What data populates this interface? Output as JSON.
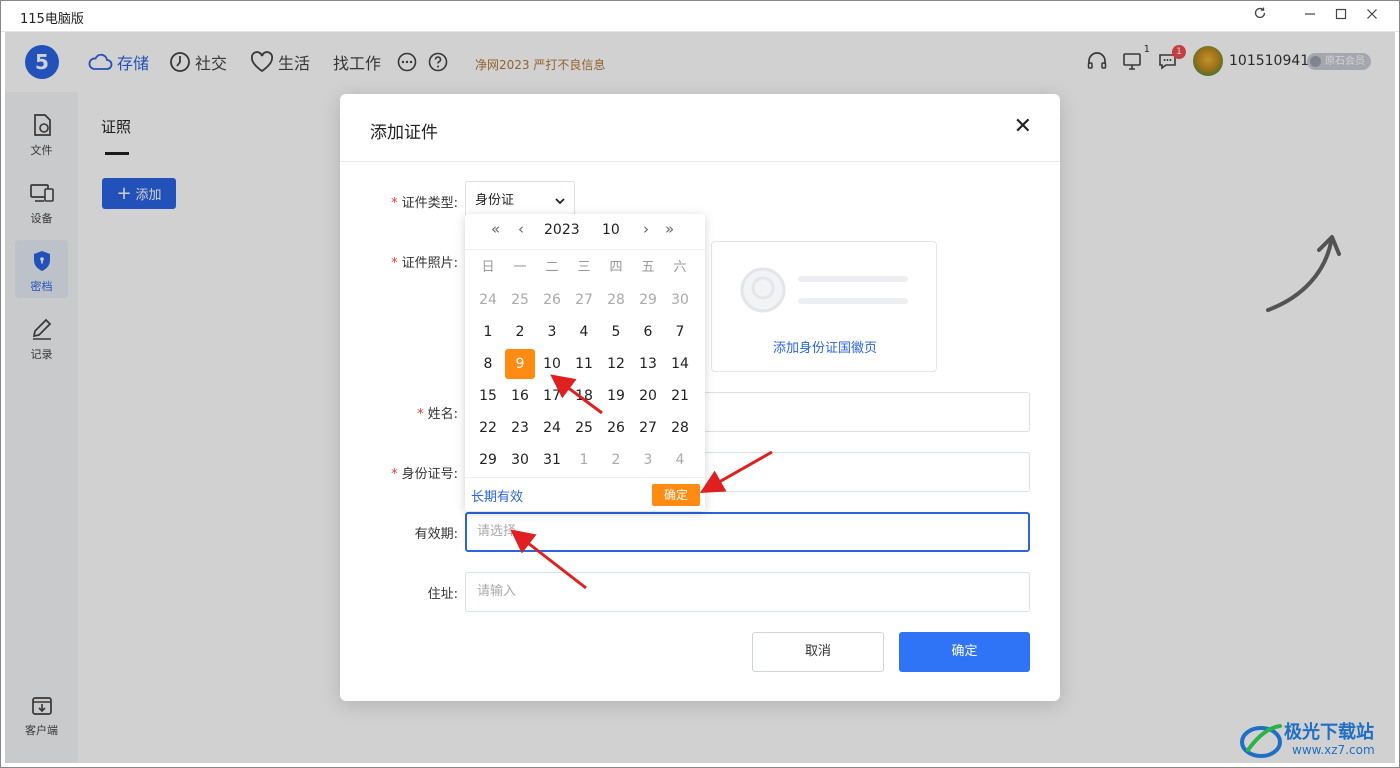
{
  "window": {
    "title": "115电脑版"
  },
  "header": {
    "logo": "5",
    "nav": [
      {
        "label": "存储",
        "icon": "cloud-icon"
      },
      {
        "label": "社交",
        "icon": "clock-icon"
      },
      {
        "label": "生活",
        "icon": "heart-icon"
      },
      {
        "label": "找工作"
      }
    ],
    "notice": "净网2023 严打不良信息",
    "screen_count": "1",
    "message_count": "1",
    "username": "101510941",
    "member_level": "原石会员"
  },
  "sidebar": {
    "items": [
      {
        "label": "文件",
        "icon": "file-icon"
      },
      {
        "label": "设备",
        "icon": "device-icon"
      },
      {
        "label": "密档",
        "icon": "shield-icon"
      },
      {
        "label": "记录",
        "icon": "edit-icon"
      }
    ],
    "bottom_item": {
      "label": "客户端",
      "icon": "download-icon"
    }
  },
  "main": {
    "tab": "证照",
    "add_button": "添加"
  },
  "dialog": {
    "title": "添加证件",
    "fields": {
      "type_label": "证件类型:",
      "type_value": "身份证",
      "photo_label": "证件照片:",
      "photo_back_text": "添加身份证国徽页",
      "name_label": "姓名:",
      "id_label": "身份证号:",
      "validity_label": "有效期:",
      "validity_placeholder": "请选择",
      "address_label": "住址:",
      "address_placeholder": "请输入"
    },
    "cancel": "取消",
    "confirm": "确定"
  },
  "datepicker": {
    "year": "2023",
    "month": "10",
    "weekdays": [
      "日",
      "一",
      "二",
      "三",
      "四",
      "五",
      "六"
    ],
    "weeks": [
      [
        {
          "d": "24",
          "o": true
        },
        {
          "d": "25",
          "o": true
        },
        {
          "d": "26",
          "o": true
        },
        {
          "d": "27",
          "o": true
        },
        {
          "d": "28",
          "o": true
        },
        {
          "d": "29",
          "o": true
        },
        {
          "d": "30",
          "o": true
        }
      ],
      [
        {
          "d": "1"
        },
        {
          "d": "2"
        },
        {
          "d": "3"
        },
        {
          "d": "4"
        },
        {
          "d": "5"
        },
        {
          "d": "6"
        },
        {
          "d": "7"
        }
      ],
      [
        {
          "d": "8"
        },
        {
          "d": "9",
          "s": true
        },
        {
          "d": "10"
        },
        {
          "d": "11"
        },
        {
          "d": "12"
        },
        {
          "d": "13"
        },
        {
          "d": "14"
        }
      ],
      [
        {
          "d": "15"
        },
        {
          "d": "16"
        },
        {
          "d": "17"
        },
        {
          "d": "18"
        },
        {
          "d": "19"
        },
        {
          "d": "20"
        },
        {
          "d": "21"
        }
      ],
      [
        {
          "d": "22"
        },
        {
          "d": "23"
        },
        {
          "d": "24"
        },
        {
          "d": "25"
        },
        {
          "d": "26"
        },
        {
          "d": "27"
        },
        {
          "d": "28"
        }
      ],
      [
        {
          "d": "29"
        },
        {
          "d": "30"
        },
        {
          "d": "31"
        },
        {
          "d": "1",
          "o": true
        },
        {
          "d": "2",
          "o": true
        },
        {
          "d": "3",
          "o": true
        },
        {
          "d": "4",
          "o": true
        }
      ]
    ],
    "long_term": "长期有效",
    "confirm": "确定"
  },
  "watermark": {
    "name": "极光下载站",
    "url": "www.xz7.com"
  },
  "colors": {
    "primary": "#2a64e2",
    "accent_orange": "#ff8b12",
    "arrow_red": "#e02020"
  }
}
